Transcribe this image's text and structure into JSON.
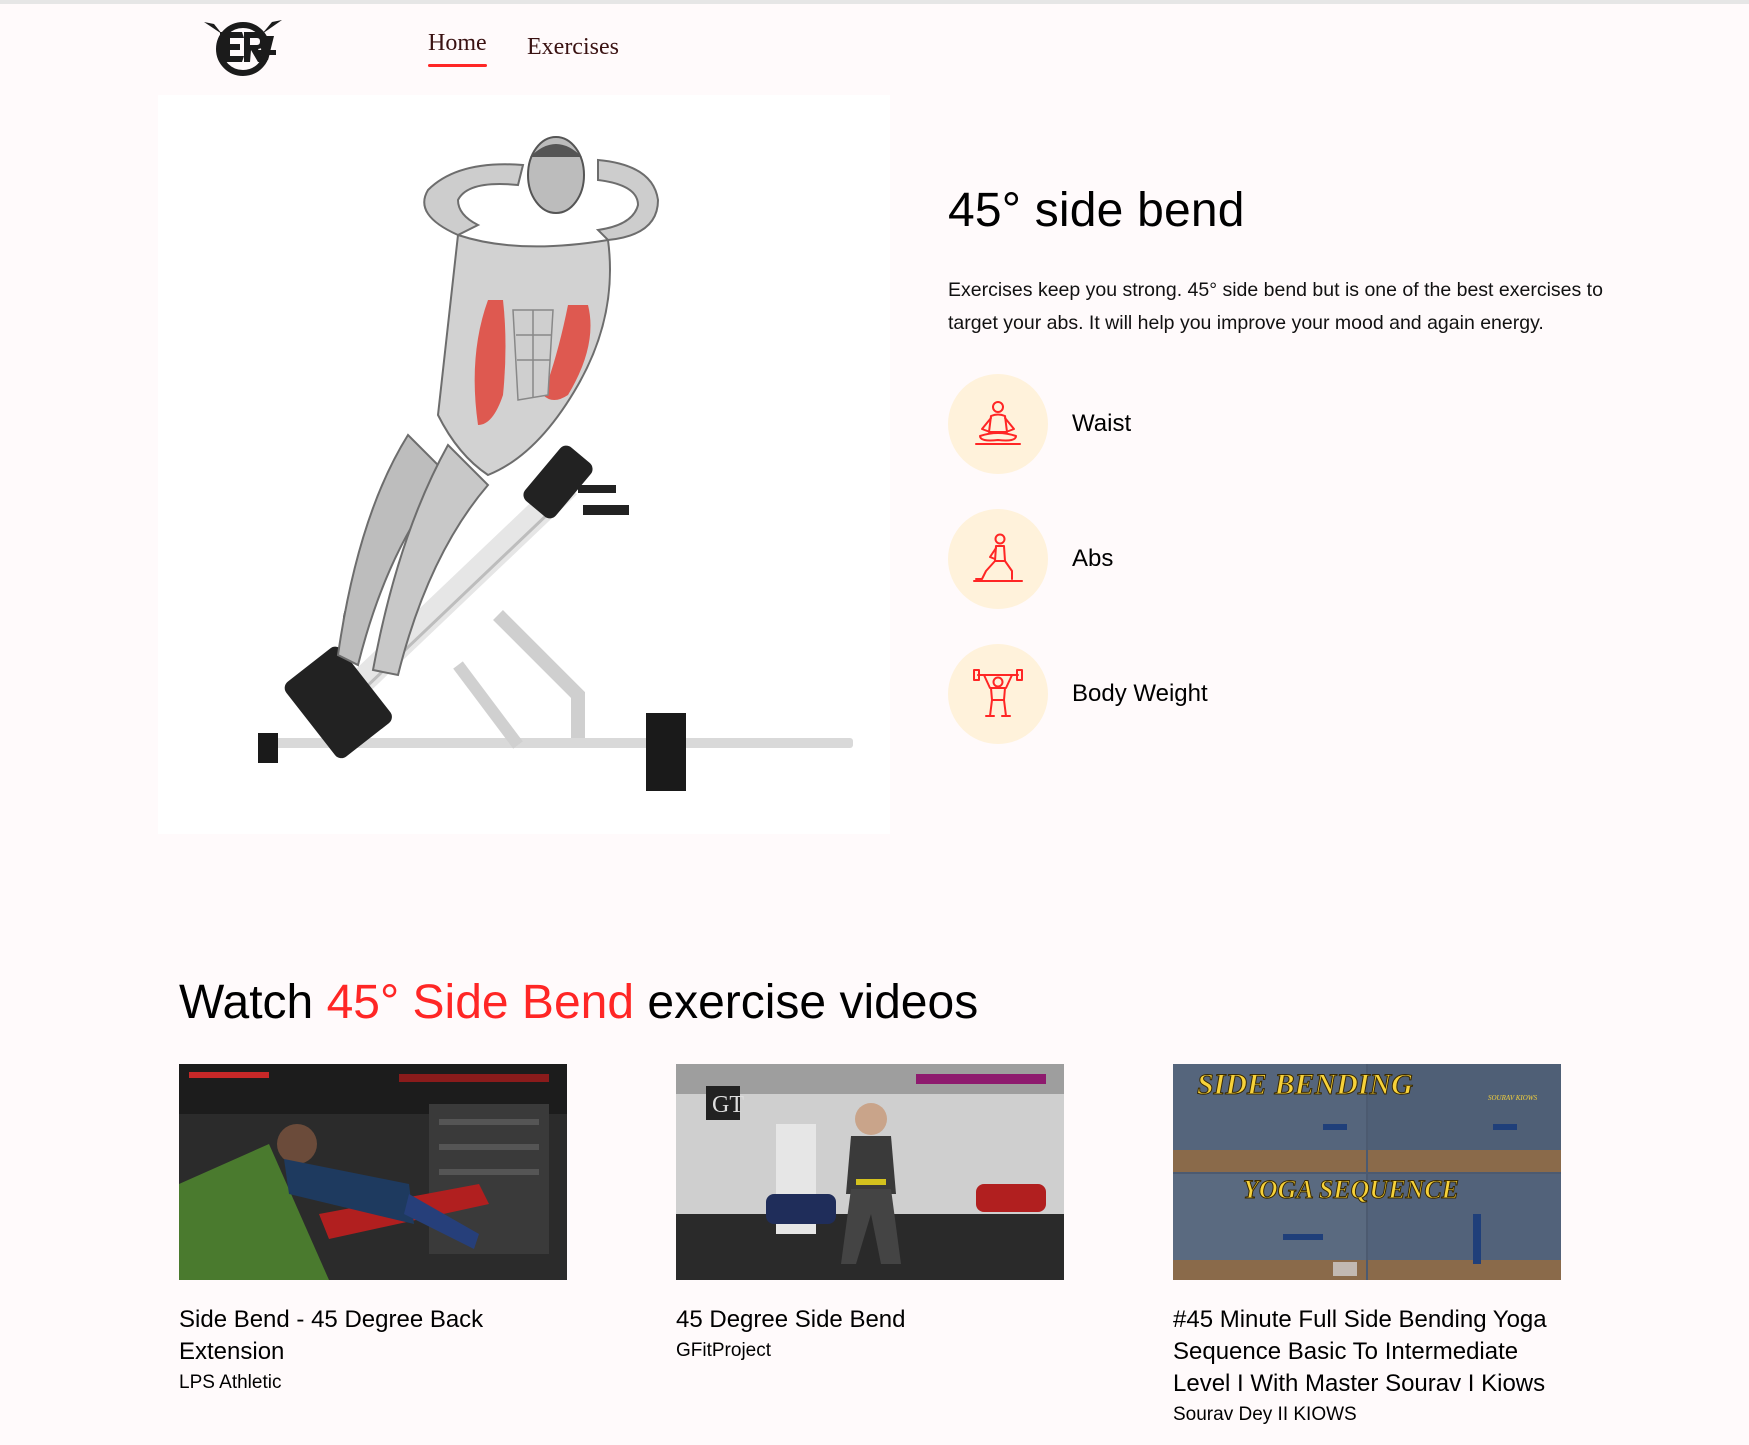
{
  "nav": {
    "home_label": "Home",
    "exercises_label": "Exercises"
  },
  "exercise": {
    "name": "45° side bend",
    "description": "Exercises keep you strong. 45° side bend but is one of the best exercises to target your abs. It will help you improve your mood and again energy.",
    "tags": [
      {
        "label": "Waist",
        "icon": "meditation-icon"
      },
      {
        "label": "Abs",
        "icon": "lunge-icon"
      },
      {
        "label": "Body Weight",
        "icon": "weightlifter-icon"
      }
    ]
  },
  "videos": {
    "title_prefix": "Watch",
    "title_highlight": "45° Side Bend",
    "title_suffix": "exercise videos",
    "items": [
      {
        "title": "Side Bend - 45 Degree Back Extension",
        "channel": "LPS Athletic"
      },
      {
        "title": "45 Degree Side Bend",
        "channel": "GFitProject"
      },
      {
        "title": "#45 Minute Full Side Bending Yoga Sequence Basic To Intermediate Level I With Master Sourav I Kiows",
        "channel": "Sourav Dey II KIOWS",
        "overlay_top": "SIDE BENDING",
        "overlay_mid": "YOGA SEQUENCE",
        "overlay_brand": "SOURAV KIOWS",
        "gt_logo": "GT"
      }
    ]
  },
  "colors": {
    "accent": "#ff2625",
    "tag_bg": "#fff2db",
    "page_bg": "#fffafb"
  }
}
